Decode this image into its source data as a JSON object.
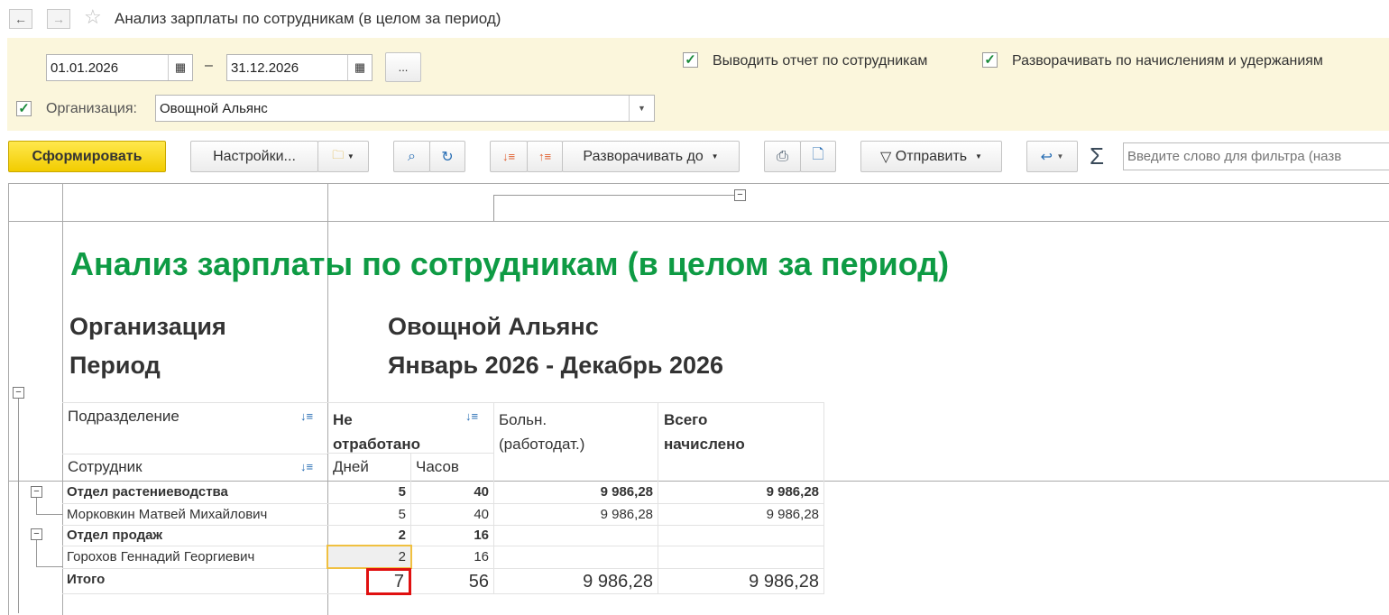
{
  "window": {
    "title": "Анализ зарплаты по сотрудникам (в целом за период)"
  },
  "params": {
    "date_from": "01.01.2026",
    "date_to": "31.12.2026",
    "dash": "–",
    "period_btn": "...",
    "show_by_employees": {
      "label": "Выводить отчет по сотрудникам",
      "checked": true
    },
    "expand_accruals": {
      "label": "Разворачивать по начислениям и удержаниям",
      "checked": true
    },
    "organization": {
      "label": "Организация:",
      "value": "Овощной Альянс",
      "checked": true
    }
  },
  "toolbar": {
    "generate": "Сформировать",
    "settings": "Настройки...",
    "expand_to": "Разворачивать до",
    "send": "Отправить",
    "filter_placeholder": "Введите слово для фильтра (назв"
  },
  "report": {
    "title": "Анализ зарплаты по сотрудникам (в целом за период)",
    "org_label": "Организация",
    "org_value": "Овощной Альянс",
    "period_label": "Период",
    "period_value": "Январь 2026 - Декабрь 2026",
    "headers": {
      "division": "Подразделение",
      "employee": "Сотрудник",
      "not_worked": "Не отработано",
      "days": "Дней",
      "hours": "Часов",
      "sick": "Больн. (работодат.)",
      "total": "Всего начислено"
    },
    "rows": [
      {
        "name": "Отдел растениеводства",
        "days": "5",
        "hours": "40",
        "sick": "9 986,28",
        "total": "9 986,28",
        "group": true
      },
      {
        "name": "Морковкин Матвей Михайлович",
        "days": "5",
        "hours": "40",
        "sick": "9 986,28",
        "total": "9 986,28",
        "group": false
      },
      {
        "name": "Отдел продаж",
        "days": "2",
        "hours": "16",
        "sick": "",
        "total": "",
        "group": true
      },
      {
        "name": "Горохов Геннадий Георгиевич",
        "days": "2",
        "hours": "16",
        "sick": "",
        "total": "",
        "group": false
      }
    ],
    "totals": {
      "label": "Итого",
      "days": "7",
      "hours": "56",
      "sick": "9 986,28",
      "total": "9 986,28"
    }
  }
}
